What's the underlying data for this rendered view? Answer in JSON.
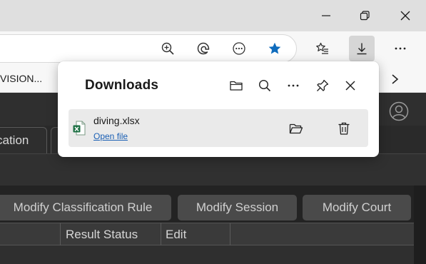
{
  "bookmarks": {
    "partial_label": "VISION..."
  },
  "page": {
    "tabs": [
      {
        "label": "cation"
      },
      {
        "label": ""
      }
    ],
    "action_buttons": [
      {
        "label": "Modify Classification Rule"
      },
      {
        "label": "Modify Session"
      },
      {
        "label": "Modify Court"
      }
    ],
    "table_headers": [
      "Result Status",
      "Edit"
    ]
  },
  "downloads": {
    "title": "Downloads",
    "items": [
      {
        "file_name": "diving.xlsx",
        "open_label": "Open file",
        "icon": "excel-file-icon"
      }
    ]
  },
  "colors": {
    "accent_blue": "#0f6cbd",
    "excel_green": "#1d7044",
    "link": "#1a5fb4"
  }
}
